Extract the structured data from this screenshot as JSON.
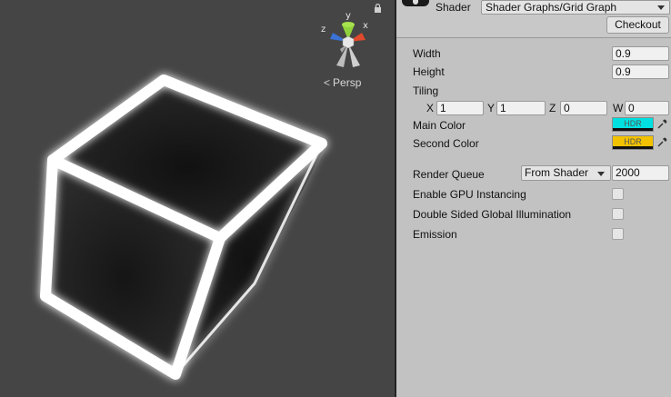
{
  "scene": {
    "gizmo": {
      "y_label": "y",
      "x_label": "x",
      "z_label": "z"
    },
    "projection_label": "Persp",
    "projection_glyph": "<"
  },
  "inspector": {
    "shader_label": "Shader",
    "shader_value": "Shader Graphs/Grid Graph",
    "checkout_label": "Checkout",
    "properties": {
      "width": {
        "label": "Width",
        "value": "0.9"
      },
      "height": {
        "label": "Height",
        "value": "0.9"
      },
      "tiling": {
        "label": "Tiling",
        "x_label": "X",
        "x_value": "1",
        "y_label": "Y",
        "y_value": "1",
        "z_label": "Z",
        "z_value": "0",
        "w_label": "W",
        "w_value": "0"
      },
      "main_color": {
        "label": "Main Color",
        "badge": "HDR",
        "color": "#00e0e0"
      },
      "second_color": {
        "label": "Second Color",
        "badge": "HDR",
        "color": "#f2c200"
      }
    },
    "render_queue": {
      "label": "Render Queue",
      "mode": "From Shader",
      "value": "2000"
    },
    "toggles": [
      {
        "label": "Enable GPU Instancing",
        "checked": false
      },
      {
        "label": "Double Sided Global Illumination",
        "checked": false
      },
      {
        "label": "Emission",
        "checked": false
      }
    ]
  },
  "colors": {
    "scene_bg": "#454545",
    "inspector_bg": "#c2c2c2",
    "gizmo_x": "#e0492b",
    "gizmo_y": "#8fd13c",
    "gizmo_z": "#3a72d6"
  }
}
